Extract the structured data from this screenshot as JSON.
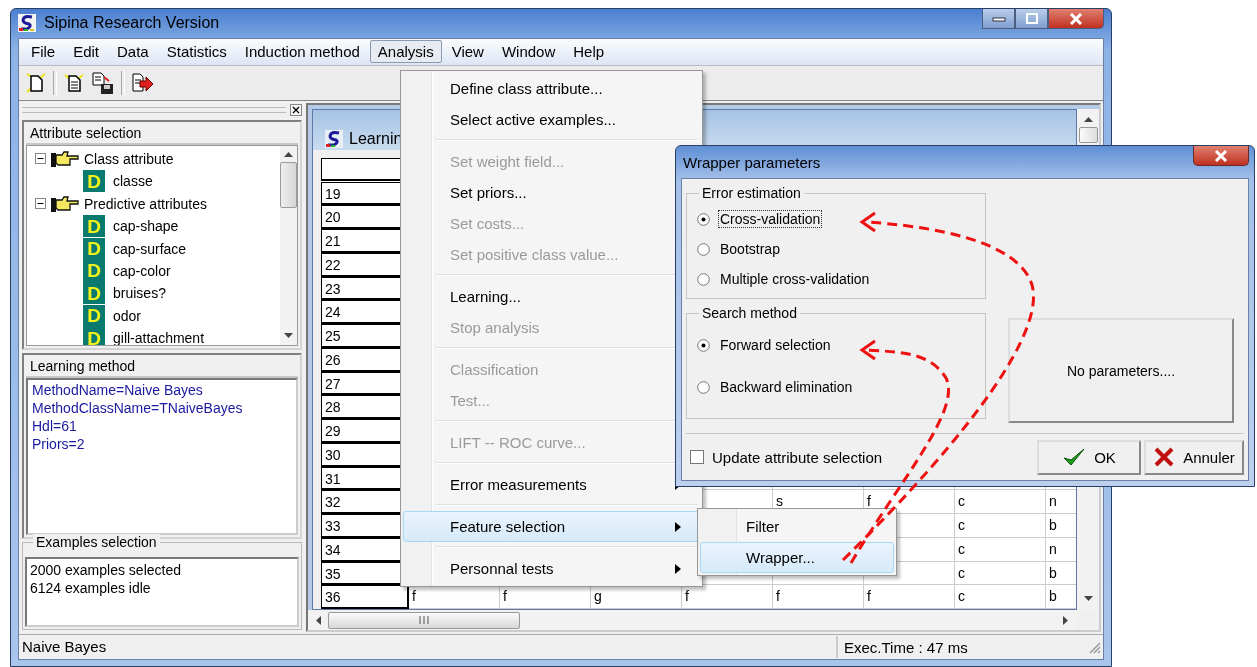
{
  "window": {
    "title": "Sipina Research Version"
  },
  "menu_bar": [
    {
      "label": "File",
      "selected": false
    },
    {
      "label": "Edit",
      "selected": false
    },
    {
      "label": "Data",
      "selected": false
    },
    {
      "label": "Statistics",
      "selected": false
    },
    {
      "label": "Induction method",
      "selected": false
    },
    {
      "label": "Analysis",
      "selected": true
    },
    {
      "label": "View",
      "selected": false
    },
    {
      "label": "Window",
      "selected": false
    },
    {
      "label": "Help",
      "selected": false
    }
  ],
  "left_panel": {
    "attribute_selection": {
      "title": "Attribute selection",
      "tree": [
        {
          "label": "Class attribute",
          "expanded": true,
          "children": [
            {
              "label": "classe",
              "badge": "D"
            }
          ]
        },
        {
          "label": "Predictive attributes",
          "expanded": true,
          "children": [
            {
              "label": "cap-shape",
              "badge": "D"
            },
            {
              "label": "cap-surface",
              "badge": "D"
            },
            {
              "label": "cap-color",
              "badge": "D"
            },
            {
              "label": "bruises?",
              "badge": "D"
            },
            {
              "label": "odor",
              "badge": "D"
            },
            {
              "label": "gill-attachment",
              "badge": "D"
            }
          ]
        }
      ]
    },
    "learning_method": {
      "title": "Learning method",
      "lines": [
        "MethodName=Naive Bayes",
        "MethodClassName=TNaiveBayes",
        "Hdl=61",
        "Priors=2"
      ]
    },
    "examples_selection": {
      "title": "Examples selection",
      "lines": [
        "2000 examples selected",
        "6124 examples idle"
      ]
    }
  },
  "learning_window": {
    "title": "Learnin",
    "rows": [
      {
        "number": "19"
      },
      {
        "number": "20"
      },
      {
        "number": "21"
      },
      {
        "number": "22"
      },
      {
        "number": "23"
      },
      {
        "number": "24"
      },
      {
        "number": "25"
      },
      {
        "number": "26"
      },
      {
        "number": "27"
      },
      {
        "number": "28"
      },
      {
        "number": "29"
      },
      {
        "number": "30"
      },
      {
        "number": "31"
      },
      {
        "number": "32",
        "cells": [
          null,
          null,
          null,
          null,
          "s",
          "f",
          "c",
          "n"
        ]
      },
      {
        "number": "33",
        "cells": [
          null,
          null,
          null,
          null,
          null,
          null,
          "c",
          "b"
        ]
      },
      {
        "number": "34",
        "cells": [
          null,
          null,
          null,
          null,
          null,
          null,
          "c",
          "n"
        ]
      },
      {
        "number": "35",
        "cells": [
          null,
          null,
          null,
          null,
          null,
          null,
          "c",
          "b"
        ]
      },
      {
        "number": "36",
        "cells": [
          "f",
          "f",
          "g",
          "f",
          "f",
          "f",
          "c",
          "b"
        ]
      }
    ]
  },
  "analysis_menu": [
    {
      "kind": "item",
      "label": "Define class attribute...",
      "disabled": false,
      "selected": false
    },
    {
      "kind": "item",
      "label": "Select active examples...",
      "disabled": false,
      "selected": false
    },
    {
      "kind": "separator"
    },
    {
      "kind": "item",
      "label": "Set weight field...",
      "disabled": true,
      "selected": false
    },
    {
      "kind": "item",
      "label": "Set priors...",
      "disabled": false,
      "selected": false
    },
    {
      "kind": "item",
      "label": "Set costs...",
      "disabled": true,
      "selected": false
    },
    {
      "kind": "item",
      "label": "Set positive class value...",
      "disabled": true,
      "selected": false
    },
    {
      "kind": "separator"
    },
    {
      "kind": "item",
      "label": "Learning...",
      "disabled": false,
      "selected": false
    },
    {
      "kind": "item",
      "label": "Stop analysis",
      "disabled": true,
      "selected": false
    },
    {
      "kind": "separator"
    },
    {
      "kind": "item",
      "label": "Classification",
      "disabled": true,
      "selected": false
    },
    {
      "kind": "item",
      "label": "Test...",
      "disabled": true,
      "selected": false
    },
    {
      "kind": "separator"
    },
    {
      "kind": "item",
      "label": "LIFT -- ROC curve...",
      "disabled": true,
      "selected": false
    },
    {
      "kind": "separator"
    },
    {
      "kind": "item",
      "label": "Error measurements",
      "disabled": false,
      "submenu": true,
      "selected": false
    },
    {
      "kind": "separator"
    },
    {
      "kind": "item",
      "label": "Feature selection",
      "disabled": false,
      "submenu": true,
      "selected": true
    },
    {
      "kind": "separator"
    },
    {
      "kind": "item",
      "label": "Personnal tests",
      "disabled": false,
      "submenu": true,
      "selected": false
    }
  ],
  "feature_selection_submenu": [
    {
      "label": "Filter",
      "selected": false
    },
    {
      "label": "Wrapper...",
      "selected": true
    }
  ],
  "dialog": {
    "title": "Wrapper parameters",
    "groups": [
      {
        "title": "Error estimation",
        "options": [
          {
            "label": "Cross-validation",
            "selected": true,
            "focused": true
          },
          {
            "label": "Bootstrap",
            "selected": false,
            "focused": false
          },
          {
            "label": "Multiple cross-validation",
            "selected": false,
            "focused": false
          }
        ]
      },
      {
        "title": "Search method",
        "options": [
          {
            "label": "Forward selection",
            "selected": true,
            "focused": false
          },
          {
            "label": "Backward elimination",
            "selected": false,
            "focused": false
          }
        ]
      }
    ],
    "parameters_panel": "No parameters....",
    "checkbox": {
      "label": "Update attribute selection",
      "checked": false
    },
    "buttons": [
      {
        "label": "OK",
        "kind": "ok"
      },
      {
        "label": "Annuler",
        "kind": "cancel"
      }
    ]
  },
  "status_bar": {
    "left": "Naive Bayes",
    "right": "Exec.Time : 47 ms"
  }
}
